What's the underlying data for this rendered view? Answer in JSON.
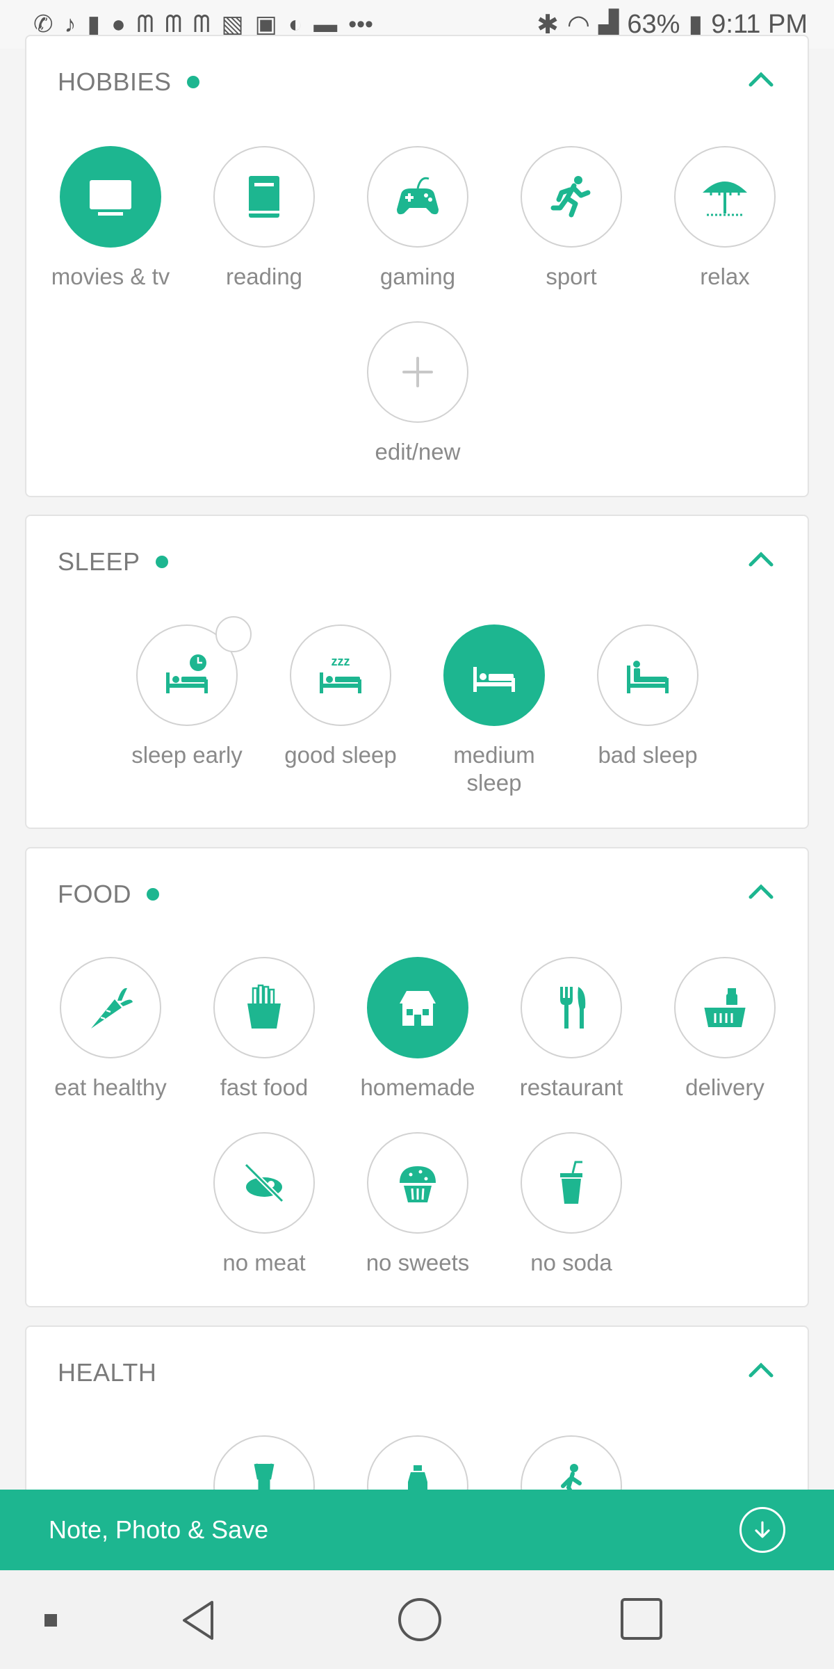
{
  "status_bar": {
    "notification_icons": [
      "whatsapp-icon",
      "tiktok-icon",
      "cup-icon",
      "bear-icon",
      "m-icon",
      "m-icon",
      "m-icon",
      "image-icon",
      "app-icon",
      "moon-icon",
      "bed-icon",
      "more-icon"
    ],
    "battery": "63%",
    "time": "9:11 PM"
  },
  "theme": {
    "accent": "#1db690"
  },
  "hobbies": {
    "title": "HOBBIES",
    "items": [
      {
        "label": "movies & tv",
        "icon": "tv-icon",
        "selected": true
      },
      {
        "label": "reading",
        "icon": "book-icon",
        "selected": false
      },
      {
        "label": "gaming",
        "icon": "gamepad-icon",
        "selected": false
      },
      {
        "label": "sport",
        "icon": "running-icon",
        "selected": false
      },
      {
        "label": "relax",
        "icon": "beach-umbrella-icon",
        "selected": false
      },
      {
        "label": "edit/new",
        "icon": "plus-icon",
        "selected": false
      }
    ]
  },
  "sleep": {
    "title": "SLEEP",
    "items": [
      {
        "label": "sleep early",
        "icon": "bed-clock-icon",
        "selected": false
      },
      {
        "label": "good sleep",
        "icon": "bed-zzz-icon",
        "selected": false
      },
      {
        "label": "medium sleep",
        "icon": "bed-icon",
        "selected": true
      },
      {
        "label": "bad sleep",
        "icon": "bed-sitting-icon",
        "selected": false
      }
    ]
  },
  "food": {
    "title": "FOOD",
    "items": [
      {
        "label": "eat healthy",
        "icon": "carrot-icon",
        "selected": false
      },
      {
        "label": "fast food",
        "icon": "fries-icon",
        "selected": false
      },
      {
        "label": "homemade",
        "icon": "house-icon",
        "selected": true
      },
      {
        "label": "restaurant",
        "icon": "cutlery-icon",
        "selected": false
      },
      {
        "label": "delivery",
        "icon": "basket-icon",
        "selected": false
      },
      {
        "label": "no meat",
        "icon": "no-meat-icon",
        "selected": false
      },
      {
        "label": "no sweets",
        "icon": "muffin-icon",
        "selected": false
      },
      {
        "label": "no soda",
        "icon": "soda-cup-icon",
        "selected": false
      }
    ]
  },
  "health": {
    "title": "HEALTH",
    "items": [
      {
        "icon": "yoga-icon"
      },
      {
        "icon": "water-bottle-icon"
      },
      {
        "icon": "walking-icon"
      }
    ]
  },
  "bottom_bar": {
    "label": "Note, Photo & Save"
  }
}
